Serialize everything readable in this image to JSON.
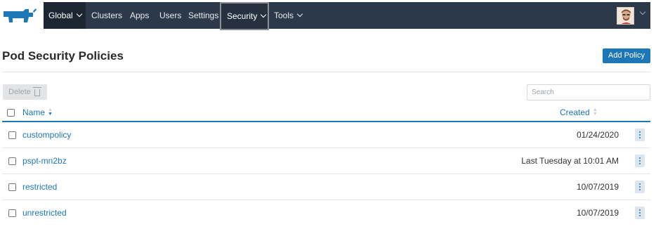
{
  "nav": {
    "items": [
      {
        "label": "Global",
        "dropdown": true
      },
      {
        "label": "Clusters"
      },
      {
        "label": "Apps"
      },
      {
        "label": "Users"
      },
      {
        "label": "Settings"
      },
      {
        "label": "Security",
        "dropdown": true
      },
      {
        "label": "Tools",
        "dropdown": true
      }
    ],
    "logo_icon": "rancher-cow-logo",
    "avatar_icon": "user-avatar"
  },
  "page": {
    "title": "Pod Security Policies",
    "add_button": "Add Policy",
    "delete_button": "Delete",
    "search_placeholder": "Search"
  },
  "table": {
    "columns": {
      "name": "Name",
      "created": "Created"
    },
    "rows": [
      {
        "name": "custompolicy",
        "created": "01/24/2020"
      },
      {
        "name": "pspt-mn2bz",
        "created": "Last Tuesday at 10:01 AM"
      },
      {
        "name": "restricted",
        "created": "10/07/2019"
      },
      {
        "name": "unrestricted",
        "created": "10/07/2019"
      }
    ]
  },
  "colors": {
    "nav_bg": "#2b394a",
    "accent": "#1d77b6",
    "logo": "#1d77b6"
  }
}
